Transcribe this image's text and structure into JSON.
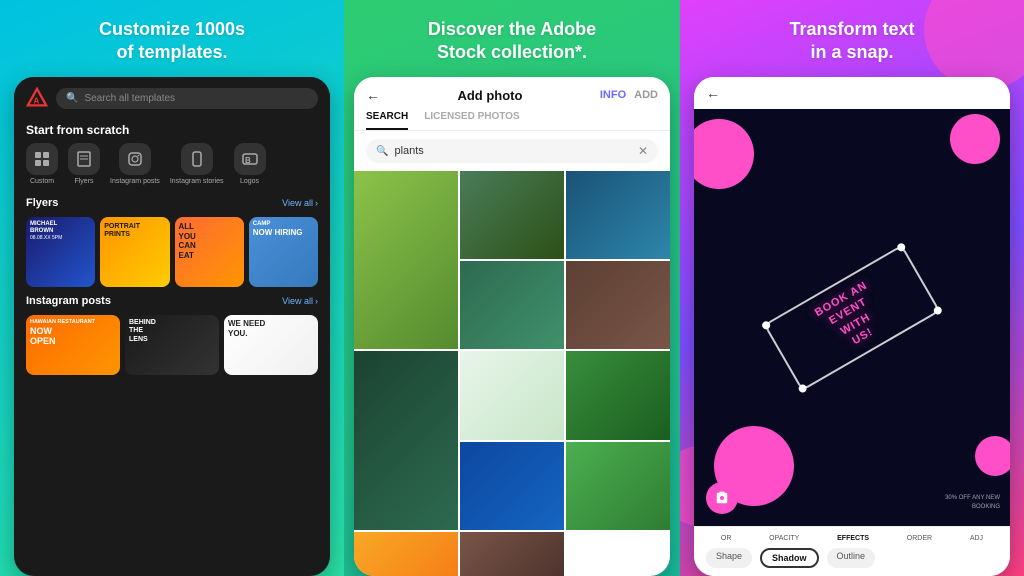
{
  "panel1": {
    "title": "Customize 1000s\nof templates.",
    "search_placeholder": "Search all templates",
    "section1": "Start from scratch",
    "icons": [
      {
        "label": "Custom",
        "icon": "⊞"
      },
      {
        "label": "Flyers",
        "icon": "📄"
      },
      {
        "label": "Instagram posts",
        "icon": "📷"
      },
      {
        "label": "Instagram\nstories",
        "icon": "📱"
      },
      {
        "label": "Logos",
        "icon": "🅱"
      }
    ],
    "section2": "Flyers",
    "view_all_1": "View all",
    "flyers": [
      {
        "text": "MICHAEL\nBROWN",
        "sub": "08.08.XX 5PM"
      },
      {
        "text": "Portrait\nPrints"
      },
      {
        "text": "All\nYou\nCan\nEat"
      },
      {
        "text": "camp\nnow hiring"
      }
    ],
    "section3": "Instagram posts",
    "view_all_2": "View all",
    "insta": [
      {
        "text": "HAWAIAN RESTAURANT\nNOW\nOPEN"
      },
      {
        "text": "BEHIND\nTHE\nLENS"
      },
      {
        "text": "We Need\nYou."
      }
    ]
  },
  "panel2": {
    "title": "Discover the Adobe\nStock collection*.",
    "back_arrow": "←",
    "header_title": "Add photo",
    "info_label": "INFO",
    "add_label": "ADD",
    "tab_search": "SEARCH",
    "tab_licensed": "LICENSED PHOTOS",
    "search_value": "plants",
    "photos": [
      "ph-1",
      "ph-2",
      "ph-3",
      "ph-4",
      "ph-5",
      "ph-6",
      "ph-7",
      "ph-8",
      "ph-9",
      "ph-10",
      "ph-11",
      "ph-12"
    ]
  },
  "panel3": {
    "title": "Transform text\nin a snap.",
    "back_arrow": "←",
    "canvas_text": "BOOK AN\nEVENT\nWITH\nUS!",
    "booking_text": "30% OFF ANY NEW\nBOOKING",
    "tools": [
      {
        "label": "OR"
      },
      {
        "label": "OPACITY"
      },
      {
        "label": "EFFECTS"
      },
      {
        "label": "ORDER"
      },
      {
        "label": "ADJ"
      }
    ],
    "effects_label": "EFFECTS",
    "subtabs": [
      "Shape",
      "Shadow",
      "Outline"
    ]
  }
}
